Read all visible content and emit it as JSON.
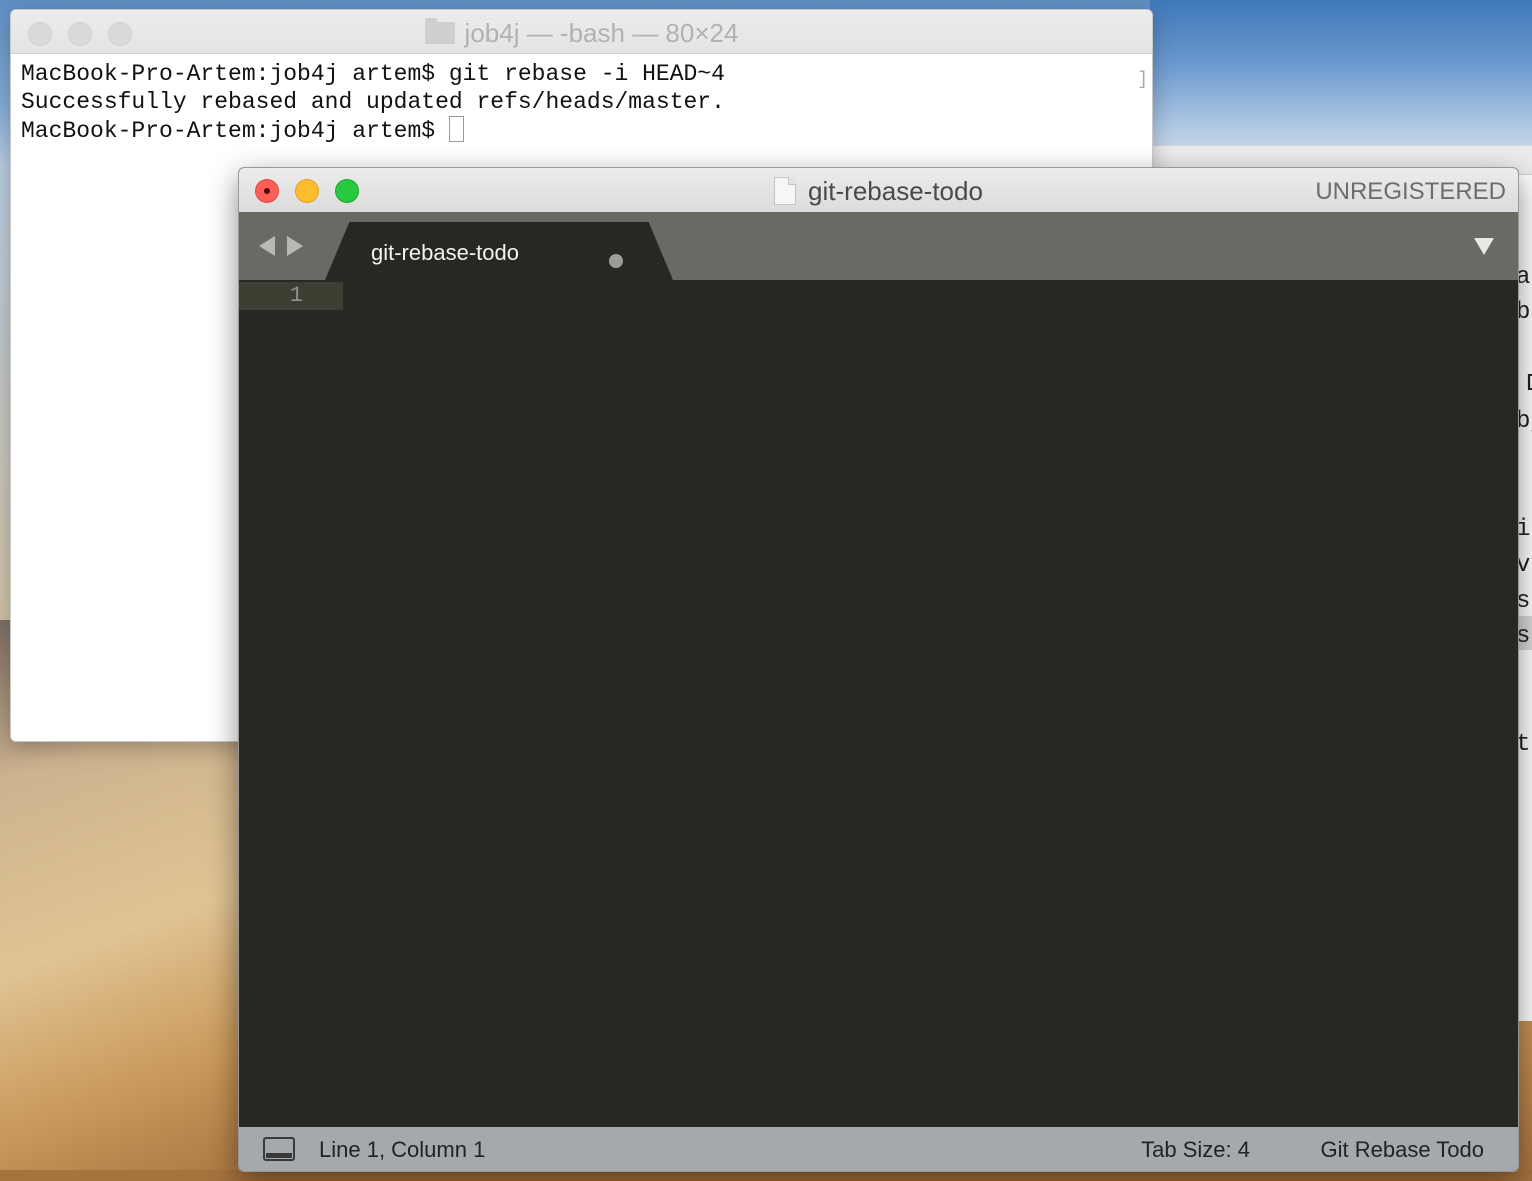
{
  "terminal": {
    "title": "job4j — -bash — 80×24",
    "lines": [
      "MacBook-Pro-Artem:job4j artem$ git rebase -i HEAD~4",
      "Successfully rebased and updated refs/heads/master.",
      "MacBook-Pro-Artem:job4j artem$ "
    ]
  },
  "background_window": {
    "text_fragments": [
      "at",
      "ba",
      "D",
      "bj",
      "in",
      "ve",
      "s",
      "s",
      "t.l"
    ]
  },
  "editor": {
    "window_title": "git-rebase-todo",
    "license_status": "UNREGISTERED",
    "tab": {
      "label": "git-rebase-todo",
      "dirty": true
    },
    "line_numbers": [
      "1"
    ],
    "status_bar": {
      "position": "Line 1, Column 1",
      "tab_size": "Tab Size: 4",
      "syntax": "Git Rebase Todo"
    }
  },
  "colors": {
    "editor_bg": "#272822",
    "tabbar_bg": "#6a6a65",
    "statusbar_bg": "#a5a9ae",
    "close": "#fc5f57",
    "minimize": "#fdbc2e",
    "maximize": "#28c840"
  }
}
